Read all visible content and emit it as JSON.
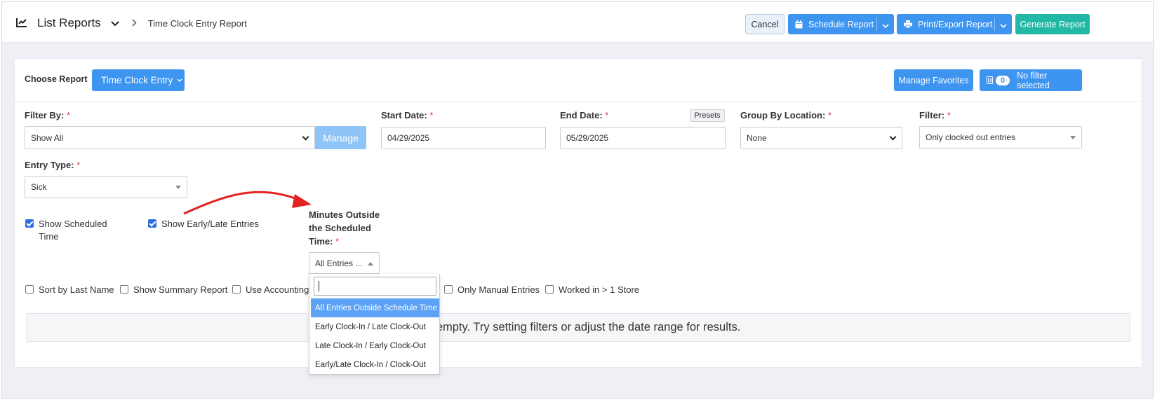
{
  "header": {
    "app_title": "List Reports",
    "breadcrumb": "Time Clock Entry Report",
    "cancel": "Cancel",
    "schedule": "Schedule Report",
    "print_export": "Print/Export Report",
    "generate": "Generate Report"
  },
  "report": {
    "choose_label": "Choose Report",
    "selected": "Time Clock Entry",
    "manage_favorites": "Manage Favorites",
    "filter_count": "0",
    "filter_status": "No filter selected"
  },
  "filters": {
    "filter_by_label": "Filter By:",
    "filter_by_value": "Show All",
    "manage": "Manage",
    "start_date_label": "Start Date:",
    "start_date": "04/29/2025",
    "end_date_label": "End Date:",
    "end_date": "05/29/2025",
    "presets": "Presets",
    "group_by_label": "Group By Location:",
    "group_by_value": "None",
    "filter_label": "Filter:",
    "filter_value": "Only clocked out entries",
    "entry_type_label": "Entry Type:",
    "entry_type_value": "Sick",
    "required_mark": "*"
  },
  "options": {
    "show_scheduled_line1": "Show Scheduled",
    "show_scheduled_line2": "Time",
    "show_early_late": "Show Early/Late Entries",
    "minutes_label_1": "Minutes Outside",
    "minutes_label_2": "the Scheduled",
    "minutes_label_3": "Time:",
    "minutes_value": "All Entries ...",
    "sort_last_name": "Sort by Last Name",
    "show_summary": "Show Summary Report",
    "use_accounting": "Use Accounting I",
    "only_manual": "Only Manual Entries",
    "worked_multi": "Worked in > 1 Store"
  },
  "dropdown": {
    "search_value": "",
    "items": [
      "All Entries Outside Schedule Time",
      "Early Clock-In / Late Clock-Out",
      "Late Clock-In / Early Clock-Out",
      "Early/Late Clock-In / Clock-Out"
    ],
    "selected_index": 0
  },
  "empty_message": "s empty. Try setting filters or adjust the date range for results.",
  "colors": {
    "primary": "#3d95f0",
    "teal": "#22b8a6",
    "required": "#e43d3d",
    "annotation_arrow": "#e52222"
  }
}
